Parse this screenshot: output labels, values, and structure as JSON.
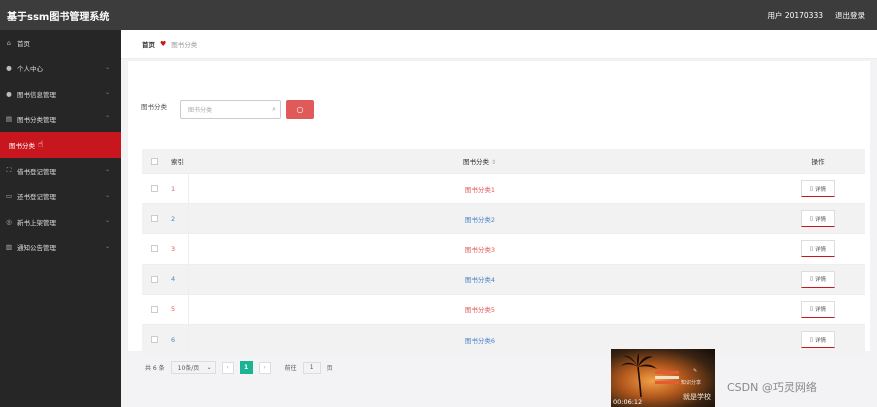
{
  "header": {
    "title": "基于ssm图书管理系统",
    "user": "用户 20170333",
    "logout": "退出登录"
  },
  "sidebar": {
    "items": [
      {
        "label": "首页",
        "icon": "home-icon"
      },
      {
        "label": "个人中心",
        "icon": "user-icon"
      },
      {
        "label": "图书信息管理",
        "icon": "user-icon"
      },
      {
        "label": "图书分类管理",
        "icon": "library-icon"
      },
      {
        "label": "借书登记管理",
        "icon": "expand-icon"
      },
      {
        "label": "还书登记管理",
        "icon": "message-icon"
      },
      {
        "label": "新书上架管理",
        "icon": "compass-icon"
      },
      {
        "label": "通知公告管理",
        "icon": "trash-icon"
      }
    ],
    "active_sub": "图书分类"
  },
  "breadcrumb": {
    "home": "首页",
    "current": "图书分类"
  },
  "search": {
    "label": "图书分类",
    "placeholder": "图书分类"
  },
  "table": {
    "headers": {
      "index": "索引",
      "name": "图书分类",
      "op": "操作"
    },
    "detail_label": "详情",
    "rows": [
      {
        "index": "1",
        "name": "图书分类1",
        "color": "#e05a5a"
      },
      {
        "index": "2",
        "name": "图书分类2",
        "color": "#4a84c8"
      },
      {
        "index": "3",
        "name": "图书分类3",
        "color": "#e05a5a"
      },
      {
        "index": "4",
        "name": "图书分类4",
        "color": "#4a84c8"
      },
      {
        "index": "5",
        "name": "图书分类5",
        "color": "#e05a5a"
      },
      {
        "index": "6",
        "name": "图书分类6",
        "color": "#4a84c8"
      }
    ]
  },
  "pagination": {
    "total": "共 6 条",
    "page_size": "10条/页",
    "current": "1",
    "goto_label": "前往",
    "goto_value": "1",
    "page_unit": "页"
  },
  "video": {
    "time": "00:06:12",
    "text_small": "知识分享",
    "text_big": "就是学校"
  },
  "watermark": "CSDN @巧灵网络"
}
